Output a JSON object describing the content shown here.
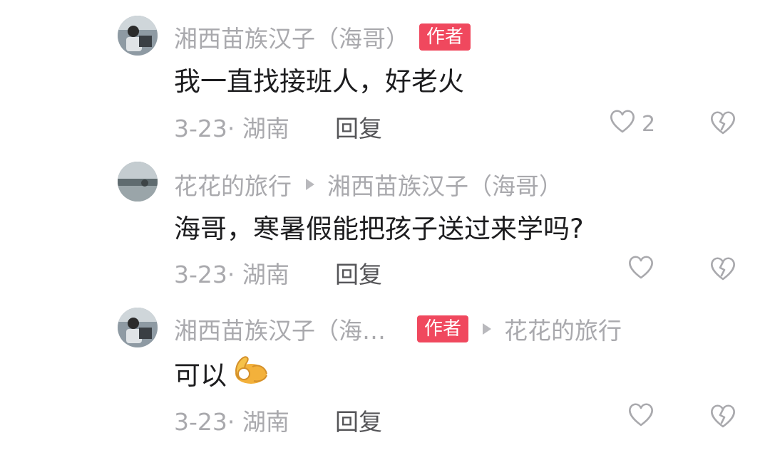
{
  "comments": [
    {
      "author": "湘西苗族汉子（海哥）",
      "badge": "作者",
      "text": "我一直找接班人，好老火",
      "meta": "3-23· 湖南",
      "reply_label": "回复",
      "like_count": "2"
    },
    {
      "author": "花花的旅行",
      "reply_to": "湘西苗族汉子（海哥）",
      "text": "海哥，寒暑假能把孩子送过来学吗?",
      "meta": "3-23· 湖南",
      "reply_label": "回复"
    },
    {
      "author": "湘西苗族汉子（海…",
      "badge": "作者",
      "reply_to": "花花的旅行",
      "text": "可以",
      "emoji": "ok-hand-emoji",
      "meta": "3-23· 湖南",
      "reply_label": "回复"
    }
  ],
  "icons": {
    "like": "heart-outline-icon",
    "dislike": "broken-heart-icon"
  },
  "colors": {
    "badge": "#f0485e",
    "secondary_text": "#a9a9ad",
    "primary_text": "#1d1d1f"
  }
}
